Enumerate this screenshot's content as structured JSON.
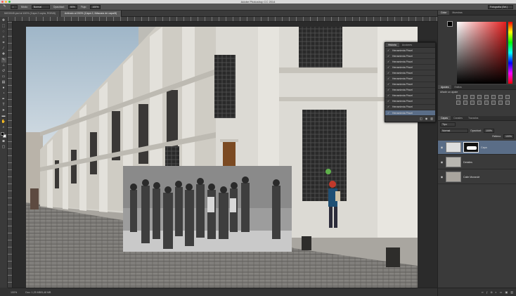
{
  "app": {
    "window_title": "Adobe Photoshop CC 2014",
    "workspace_select": "Fotografía (Sel.)"
  },
  "options_bar": {
    "mode_label": "Modo:",
    "mode_value": "Normal",
    "opacity_label": "Opacidad:",
    "opacity_value": "90%",
    "flow_label": "Flujo:",
    "flow_value": "100%"
  },
  "document_tabs": [
    {
      "label": "IMG0045.psd al 100% (Capa 2 copia, RGB/8)",
      "active": false
    },
    {
      "label": "Antivalo al 200% (Capa 2, Máscara de capa/8)",
      "active": true
    }
  ],
  "status_bar": {
    "zoom": "100%",
    "doc_size": "Doc: 1,25 MB/5,48 MB"
  },
  "color_panel": {
    "tabs": [
      "Color",
      "Muestras"
    ],
    "active_tab": "Color",
    "foreground_color": "#000000",
    "background_color": "#ffffff",
    "field_hue_color": "#e41e1e"
  },
  "adjustments_panel": {
    "tabs": [
      "Ajustes",
      "Estilos"
    ],
    "active_tab": "Ajustes",
    "heading": "Añadir un ajuste"
  },
  "layers_panel": {
    "tabs": [
      "Capas",
      "Canales",
      "Trazados"
    ],
    "active_tab": "Capas",
    "filter_value": "Tipo",
    "blend_mode": "Normal",
    "opacity_label": "Opacidad:",
    "opacity_value": "100%",
    "fill_label": "Relleno:",
    "fill_value": "100%",
    "layers": [
      {
        "name": "Capa",
        "visible": true,
        "active": true,
        "has_mask": true
      },
      {
        "name": "Detalles",
        "visible": true,
        "active": false,
        "has_mask": false
      },
      {
        "name": "Calle Morandé",
        "visible": true,
        "active": false,
        "has_mask": false
      }
    ]
  },
  "history_panel": {
    "tabs": [
      "Historia",
      "Acciones"
    ],
    "active_tab": "Historia",
    "items": [
      "Herramienta Pincel",
      "Herramienta Pincel",
      "Herramienta Pincel",
      "Herramienta Pincel",
      "Herramienta Pincel",
      "Herramienta Pincel",
      "Herramienta Pincel",
      "Herramienta Pincel",
      "Herramienta Pincel",
      "Herramienta Pincel",
      "Herramienta Pincel",
      "Herramienta Pincel"
    ],
    "selected_index": 11
  },
  "tools": [
    "move",
    "marquee",
    "lasso",
    "quick-select",
    "crop",
    "eyedropper",
    "healing",
    "brush",
    "clone-stamp",
    "history-brush",
    "eraser",
    "gradient",
    "blur",
    "dodge",
    "pen",
    "type",
    "path-select",
    "shape",
    "hand",
    "zoom"
  ]
}
